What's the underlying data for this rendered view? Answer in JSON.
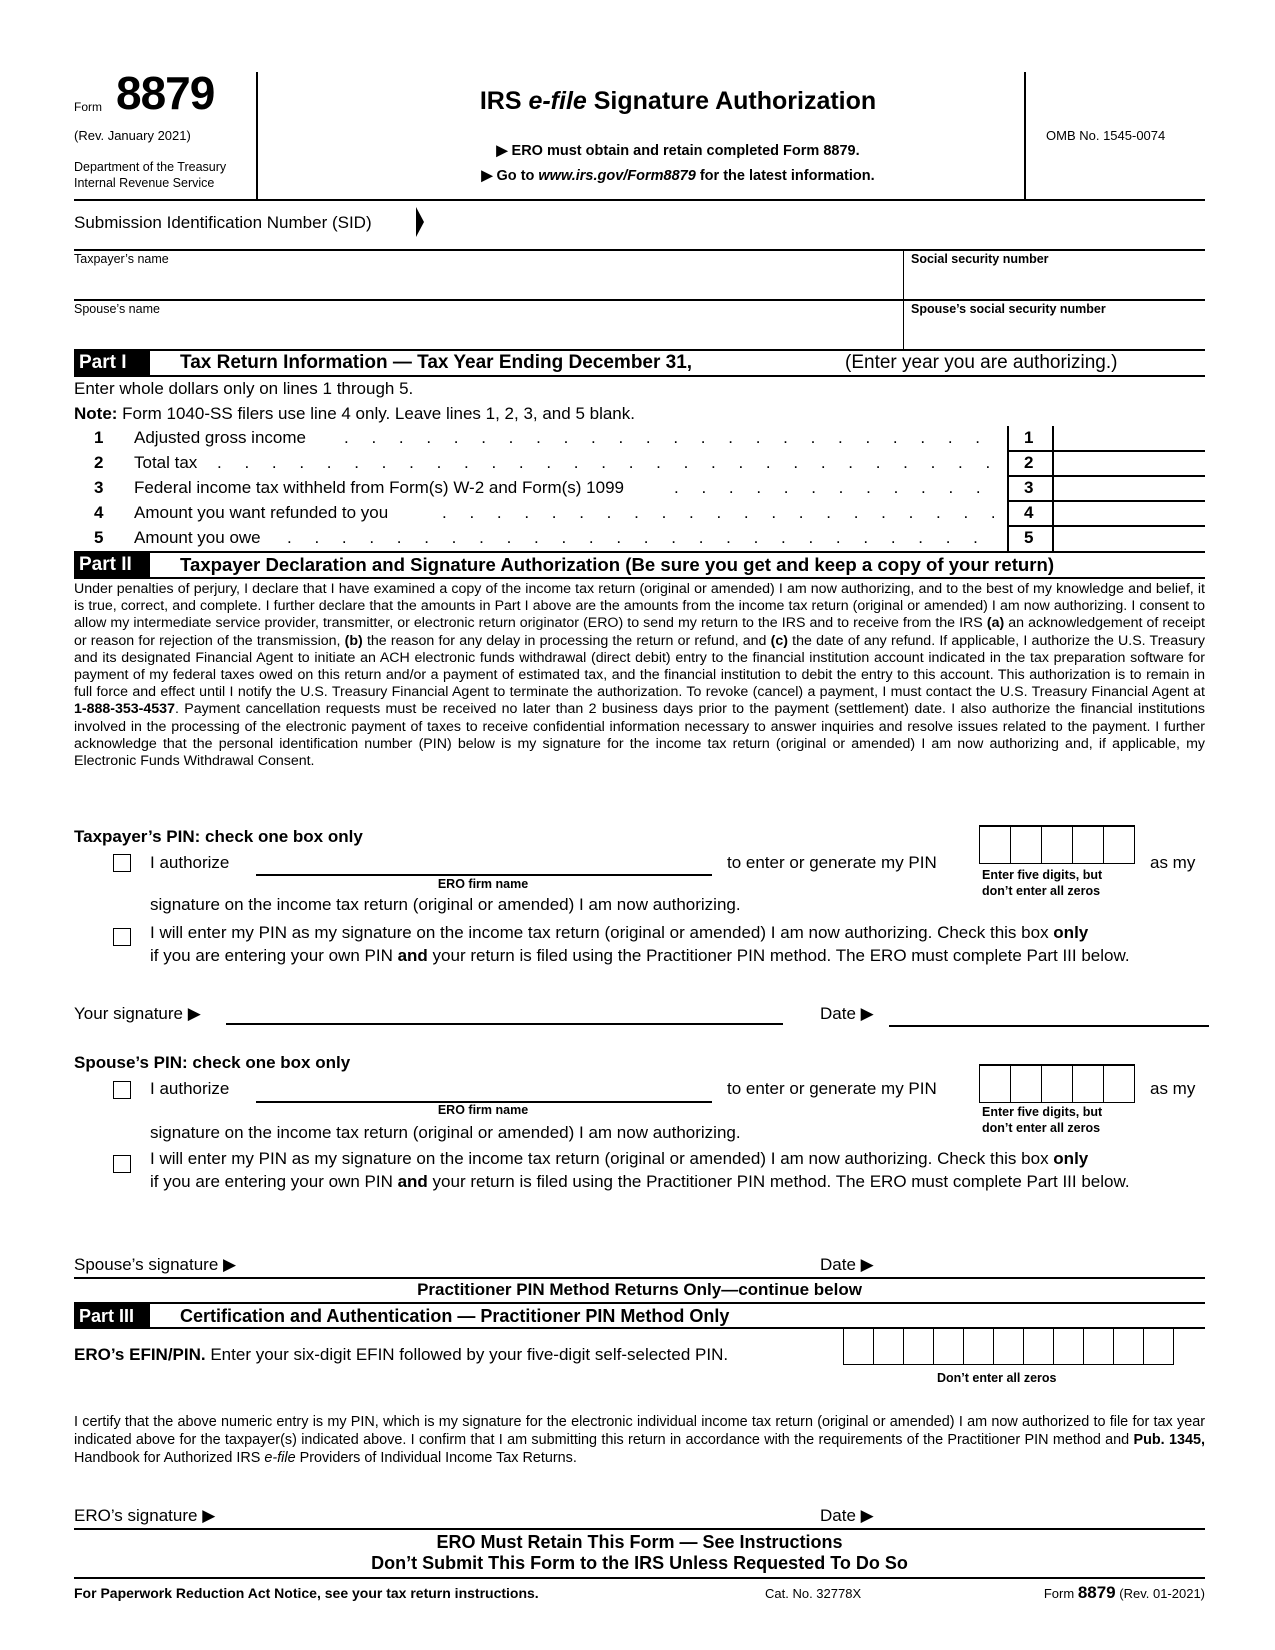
{
  "header": {
    "form_word": "Form",
    "form_number": "8879",
    "revision": "(Rev. January 2021)",
    "department": "Department of the Treasury",
    "agency": "Internal Revenue Service",
    "title_prefix": "IRS ",
    "title_italic": "e-file",
    "title_suffix": " Signature Authorization",
    "instruction_1": "▶ ERO must obtain and retain completed Form 8879.",
    "instruction_2_prefix": "▶ Go to ",
    "instruction_2_link": "www.irs.gov/Form8879",
    "instruction_2_suffix": " for the latest information.",
    "omb": "OMB No. 1545-0074"
  },
  "sid": {
    "label": "Submission Identification Number (SID)",
    "value": ""
  },
  "identity": {
    "taxpayer_name_label": "Taxpayer’s name",
    "taxpayer_name_value": "",
    "ssn_label": "Social security number",
    "ssn_value": "",
    "spouse_name_label": "Spouse’s name",
    "spouse_name_value": "",
    "spouse_ssn_label": "Spouse’s social security number",
    "spouse_ssn_value": ""
  },
  "part1": {
    "label": "Part I",
    "title": "Tax Return Information — Tax Year Ending December 31,",
    "year_value": "",
    "year_hint": "(Enter year you are authorizing.)",
    "intro": "Enter whole dollars only on lines 1 through 5.",
    "note_bold": "Note:",
    "note_text": " Form 1040-SS filers use line 4 only. Leave lines 1, 2, 3, and 5 blank.",
    "lines": [
      {
        "num": "1",
        "label": "Adjusted gross income",
        "value": ""
      },
      {
        "num": "2",
        "label": "Total tax",
        "value": ""
      },
      {
        "num": "3",
        "label": "Federal income tax withheld from Form(s) W-2 and Form(s) 1099",
        "value": ""
      },
      {
        "num": "4",
        "label": "Amount you want refunded to you",
        "value": ""
      },
      {
        "num": "5",
        "label": "Amount you owe",
        "value": ""
      }
    ]
  },
  "part2": {
    "label": "Part II",
    "title": "Taxpayer Declaration and Signature Authorization (Be sure you get and keep a copy of your return)",
    "declaration_1": "Under penalties of perjury, I declare that I have examined a copy of the income tax return (original or amended) I am now authorizing, and to the best of my knowledge and belief, it is true, correct, and complete. I further declare that the amounts in Part I above are the amounts from the income tax return (original or amended) I am now authorizing. I consent to allow my intermediate service provider, transmitter, or electronic return originator (ERO) to send my return to the IRS and to receive from the IRS ",
    "declaration_a": "(a)",
    "declaration_2": " an acknowledgement of receipt or reason for rejection of the transmission, ",
    "declaration_b": "(b)",
    "declaration_3": " the reason for any delay in processing the return or refund, and ",
    "declaration_c": "(c)",
    "declaration_4": " the date of any refund. If applicable, I authorize the U.S. Treasury and its designated Financial Agent to initiate an ACH electronic funds withdrawal (direct debit) entry to the financial institution account indicated in the tax preparation software for payment of my federal taxes owed on this return and/or a payment of estimated tax, and the financial institution to debit the entry to this account. This authorization is to remain in full force and effect until I notify the U.S. Treasury Financial Agent to terminate the authorization. To revoke (cancel) a payment, I must contact the U.S. Treasury Financial Agent at ",
    "phone": "1-888-353-4537",
    "declaration_5": ". Payment cancellation requests must be received no later than 2 business days prior to the payment (settlement) date. I also authorize the financial institutions involved in the processing of the electronic payment of taxes to receive confidential information necessary to answer inquiries and resolve issues related to the payment. I further acknowledge that the personal identification number (PIN) below is my signature for the income tax return (original or amended) I am now authorizing and, if applicable, my Electronic Funds Withdrawal Consent.",
    "taxpayer_pin": {
      "heading": "Taxpayer’s PIN: check one box only",
      "authorize_label": "I authorize",
      "ero_firm_value": "",
      "ero_firm_caption": "ERO firm name",
      "enter_generate": "to enter or generate my PIN",
      "as_my": "as my",
      "pin_hint_1": "Enter five digits, but",
      "pin_hint_2": "don’t enter all zeros",
      "signature_continuation": "signature on the income tax return (original or amended) I am now authorizing.",
      "self_enter_1": "I will enter my PIN as my signature on the income tax return (original or amended) I am now authorizing. Check this box ",
      "self_enter_only": "only",
      "self_enter_2": "if you are entering your own PIN ",
      "self_enter_and": "and",
      "self_enter_3": " your return is filed using the Practitioner PIN method. The ERO must complete Part III below.",
      "authorize_checked": false,
      "self_enter_checked": false
    },
    "your_signature_label": "Your signature ▶",
    "date_label": "Date ▶",
    "spouse_pin": {
      "heading": "Spouse’s PIN: check one box only",
      "authorize_label": "I authorize",
      "ero_firm_value": "",
      "ero_firm_caption": "ERO firm name",
      "enter_generate": "to enter or generate my PIN",
      "as_my": "as my",
      "pin_hint_1": "Enter five digits, but",
      "pin_hint_2": "don’t enter all zeros",
      "signature_continuation": "signature on the income tax return (original or amended) I am now authorizing.",
      "self_enter_1": "I will enter my PIN as my signature on the income tax return (original or amended) I am now authorizing. Check this box ",
      "self_enter_only": "only",
      "self_enter_2": "if you are entering your own PIN ",
      "self_enter_and": "and",
      "self_enter_3": " your return is filed using the Practitioner PIN method. The ERO must complete Part III below.",
      "authorize_checked": false,
      "self_enter_checked": false
    },
    "spouse_signature_label": "Spouse’s signature ▶",
    "spouse_date_label": "Date ▶"
  },
  "practitioner_heading": "Practitioner PIN Method Returns Only—continue below",
  "part3": {
    "label": "Part III",
    "title": "Certification and Authentication — Practitioner PIN Method Only",
    "efin_bold": "ERO’s EFIN/PIN.",
    "efin_text": " Enter your six-digit EFIN followed by your five-digit self-selected PIN.",
    "efin_hint": "Don’t enter all zeros",
    "certify_1": "I certify that the above numeric entry is my PIN, which is my signature for the electronic individual income tax return (original or amended) I am now authorized to file for tax year indicated above for the taxpayer(s) indicated above. I confirm that I am submitting this return in accordance with the requirements of the Practitioner PIN method and ",
    "certify_pub": "Pub. 1345,",
    "certify_2": " Handbook for Authorized IRS ",
    "certify_efile": "e-file",
    "certify_3": " Providers of Individual Income Tax Returns.",
    "ero_signature_label": "ERO’s signature ▶",
    "date_label": "Date ▶"
  },
  "retain_notice": {
    "line_1": "ERO Must Retain This Form — See Instructions",
    "line_2": "Don’t Submit This Form to the IRS Unless Requested To Do So"
  },
  "footer": {
    "paperwork": "For Paperwork Reduction Act Notice, see your tax return instructions.",
    "cat_no": "Cat. No. 32778X",
    "form_word": "Form ",
    "form_number": "8879",
    "revision": " (Rev. 01-2021)"
  }
}
